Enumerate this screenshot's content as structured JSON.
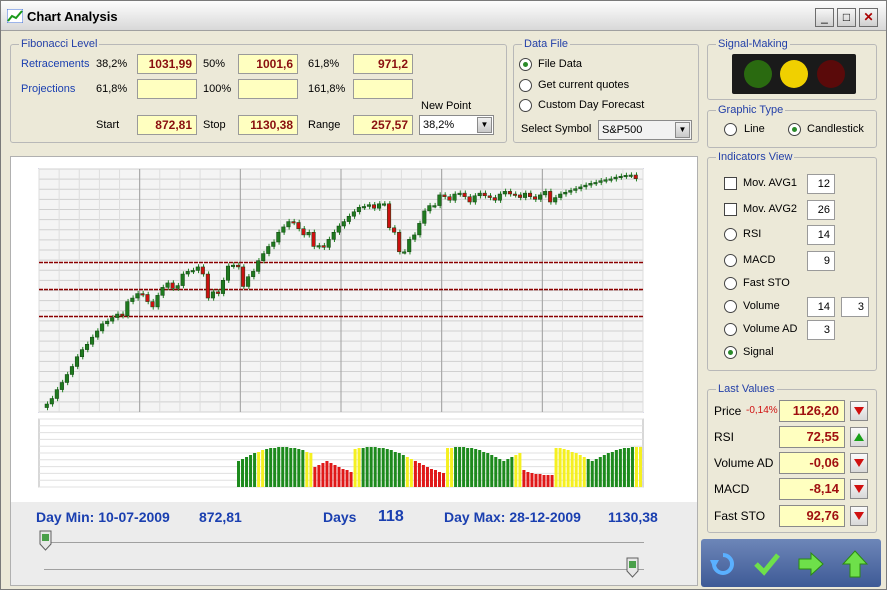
{
  "window": {
    "title": "Chart Analysis",
    "min": "_",
    "max": "□",
    "close": "✕"
  },
  "fib": {
    "label": "Fibonacci Level",
    "retracements": "Retracements",
    "projections": "Projections",
    "r1_pct": "38,2%",
    "r1_val": "1031,99",
    "r2_pct": "50%",
    "r2_val": "1001,6",
    "r3_pct": "61,8%",
    "r3_val": "971,2",
    "p1_pct": "61,8%",
    "p1_val": "",
    "p2_pct": "100%",
    "p2_val": "",
    "p3_pct": "161,8%",
    "p3_val": "",
    "start_label": "Start",
    "start_val": "872,81",
    "stop_label": "Stop",
    "stop_val": "1130,38",
    "range_label": "Range",
    "range_val": "257,57",
    "newpoint_label": "New Point",
    "newpoint_val": "38,2%"
  },
  "datafile": {
    "label": "Data File",
    "opt1": "File Data",
    "opt2": "Get current quotes",
    "opt3": "Custom Day Forecast",
    "symbol_label": "Select Symbol",
    "symbol_val": "S&P500"
  },
  "signal": {
    "label": "Signal-Making"
  },
  "graphic": {
    "label": "Graphic Type",
    "line": "Line",
    "candle": "Candlestick"
  },
  "indicators": {
    "label": "Indicators View",
    "mavg1": "Mov. AVG1",
    "mavg1_val": "12",
    "mavg2": "Mov. AVG2",
    "mavg2_val": "26",
    "rsi": "RSI",
    "rsi_val": "14",
    "macd": "MACD",
    "macd_val": "9",
    "faststo": "Fast STO",
    "volume": "Volume",
    "volume_val1": "14",
    "volume_val2": "3",
    "volad": "Volume AD",
    "volad_val": "3",
    "signal": "Signal"
  },
  "last": {
    "label": "Last Values",
    "price": "Price",
    "price_chg": "-0,14%",
    "price_val": "1126,20",
    "rsi": "RSI",
    "rsi_val": "72,55",
    "volad": "Volume AD",
    "volad_val": "-0,06",
    "macd": "MACD",
    "macd_val": "-8,14",
    "faststo": "Fast STO",
    "faststo_val": "92,76"
  },
  "bottom": {
    "daymin": "Day Min: 10-07-2009",
    "daymin_val": "872,81",
    "days": "Days",
    "days_val": "118",
    "daymax": "Day Max: 28-12-2009",
    "daymax_val": "1130,38"
  },
  "colors": {
    "up": "#1f7a1f",
    "down": "#cc1010",
    "fib_line": "#8b0000",
    "vol_green": "#1d8a1d",
    "vol_red": "#e01818",
    "vol_yellow": "#f5f020"
  },
  "chart_data": {
    "type": "candlestick",
    "ylim": [
      872.81,
      1130.38
    ],
    "fib_levels": [
      1031.99,
      1001.6,
      971.2
    ],
    "close": [
      872.81,
      879,
      889,
      897,
      906,
      915,
      926,
      934,
      940,
      948,
      955,
      963,
      966,
      970,
      974,
      972,
      988,
      992,
      997,
      996,
      988,
      982,
      995,
      1004,
      1009,
      1003,
      1006,
      1019,
      1022,
      1023,
      1027,
      1019,
      992,
      999,
      997,
      1012,
      1028,
      1029,
      1027,
      1005,
      1016,
      1022,
      1034,
      1042,
      1050,
      1055,
      1066,
      1072,
      1078,
      1077,
      1070,
      1063,
      1066,
      1050,
      1051,
      1049,
      1058,
      1066,
      1073,
      1078,
      1084,
      1089,
      1094,
      1095,
      1097,
      1093,
      1098,
      1098,
      1071,
      1066,
      1044,
      1044,
      1058,
      1063,
      1076,
      1090,
      1096,
      1096,
      1108,
      1106,
      1102,
      1109,
      1110,
      1106,
      1100,
      1107,
      1110,
      1107,
      1105,
      1102,
      1109,
      1112,
      1109,
      1108,
      1105,
      1110,
      1106,
      1103,
      1108,
      1112,
      1100,
      1105,
      1109,
      1111,
      1113,
      1115,
      1117,
      1119,
      1121,
      1122,
      1124,
      1125,
      1126,
      1128,
      1129,
      1130,
      1130.38,
      1126.2
    ],
    "volume_signal": [
      "g",
      "g",
      "g",
      "g",
      "g",
      "y",
      "y",
      "g",
      "g",
      "g",
      "g",
      "g",
      "g",
      "g",
      "g",
      "g",
      "g",
      "y",
      "y",
      "r",
      "r",
      "r",
      "r",
      "r",
      "r",
      "r",
      "r",
      "r",
      "r",
      "y",
      "y",
      "g",
      "g",
      "g",
      "g",
      "g",
      "g",
      "g",
      "g",
      "g",
      "g",
      "g",
      "y",
      "y",
      "r",
      "r",
      "r",
      "r",
      "r",
      "r",
      "r",
      "r",
      "y",
      "y",
      "g",
      "g",
      "g",
      "g",
      "g",
      "g",
      "g",
      "g",
      "g",
      "g",
      "g",
      "g",
      "g",
      "g",
      "g",
      "y",
      "y",
      "r",
      "r",
      "r",
      "r",
      "r",
      "r",
      "r",
      "r",
      "y",
      "y",
      "y",
      "y",
      "y",
      "y",
      "y",
      "y",
      "g",
      "g",
      "g",
      "g",
      "g",
      "g",
      "g",
      "g",
      "g",
      "g",
      "g",
      "g",
      "y",
      "y"
    ]
  }
}
